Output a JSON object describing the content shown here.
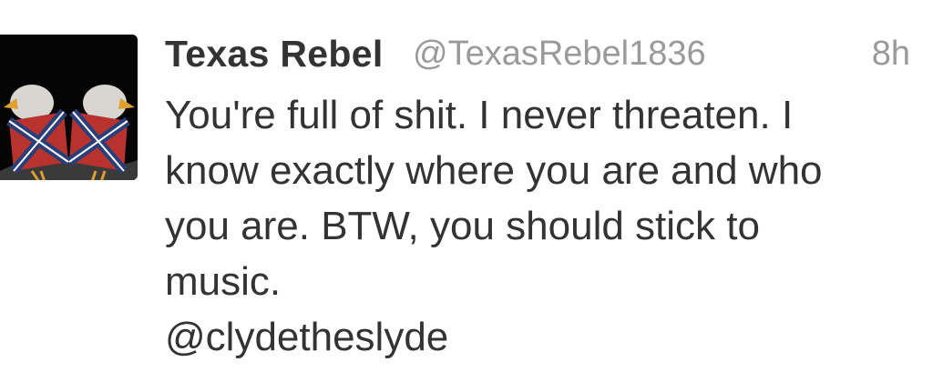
{
  "tweet": {
    "author_name": "Texas Rebel",
    "author_handle": "@TexasRebel1836",
    "timestamp": "8h",
    "text_lines": [
      "You're full of shit. I never threaten. I",
      "know exactly where you are and who",
      "you are. BTW, you should stick to",
      "music.",
      "@clydetheslyde"
    ]
  },
  "colors": {
    "text": "#333333",
    "meta": "#9a9a9a",
    "background": "#ffffff",
    "avatar_bg": "#050505"
  },
  "icons": {
    "avatar": "profile-avatar-eagles-flag"
  }
}
